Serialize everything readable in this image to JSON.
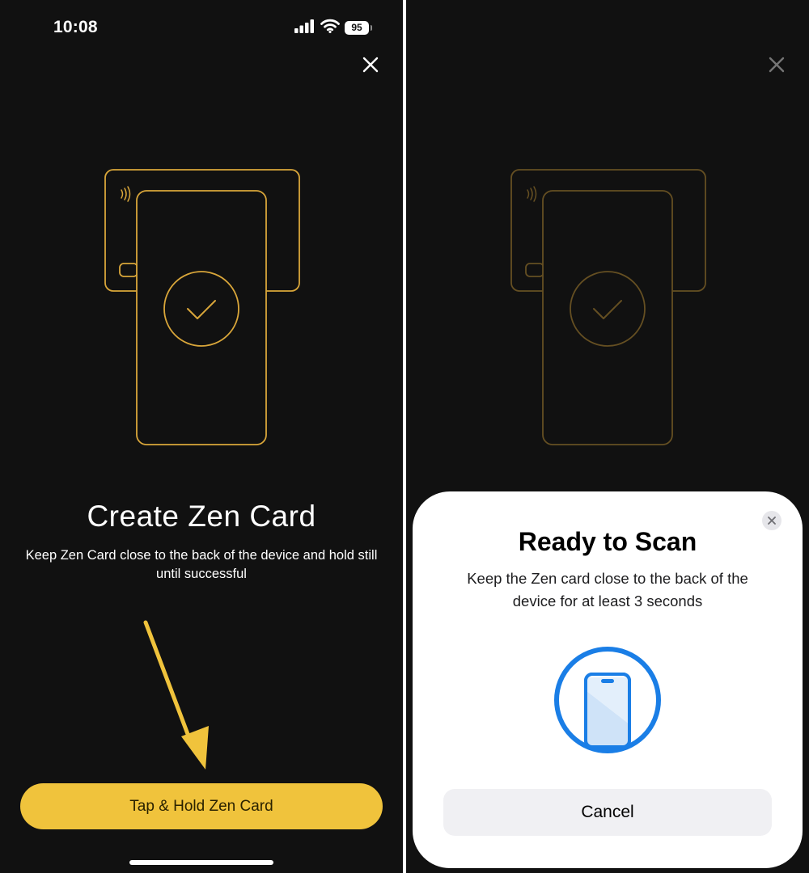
{
  "status_bar": {
    "time": "10:08",
    "battery": "95",
    "icons": [
      "cellular-signal-icon",
      "wifi-icon",
      "battery-icon"
    ]
  },
  "create_screen": {
    "title": "Create Zen Card",
    "subtitle": "Keep Zen Card close to the back of the device and hold still until successful",
    "primary_button": "Tap & Hold Zen Card",
    "illustration_icons": [
      "card-outline-icon",
      "contactless-icon",
      "phone-outline-icon",
      "checkmark-icon"
    ],
    "annotation": "arrow-pointer-icon"
  },
  "scan_sheet": {
    "title": "Ready to Scan",
    "message": "Keep the Zen card close to the back of the device for at least 3 seconds",
    "cancel_button": "Cancel",
    "icon": "nfc-phone-icon"
  },
  "colors": {
    "background": "#111111",
    "accent_gold": "#f0c33c",
    "outline_gold": "#d9a63a",
    "scan_blue": "#1a7ee6",
    "sheet_bg": "#ffffff"
  }
}
